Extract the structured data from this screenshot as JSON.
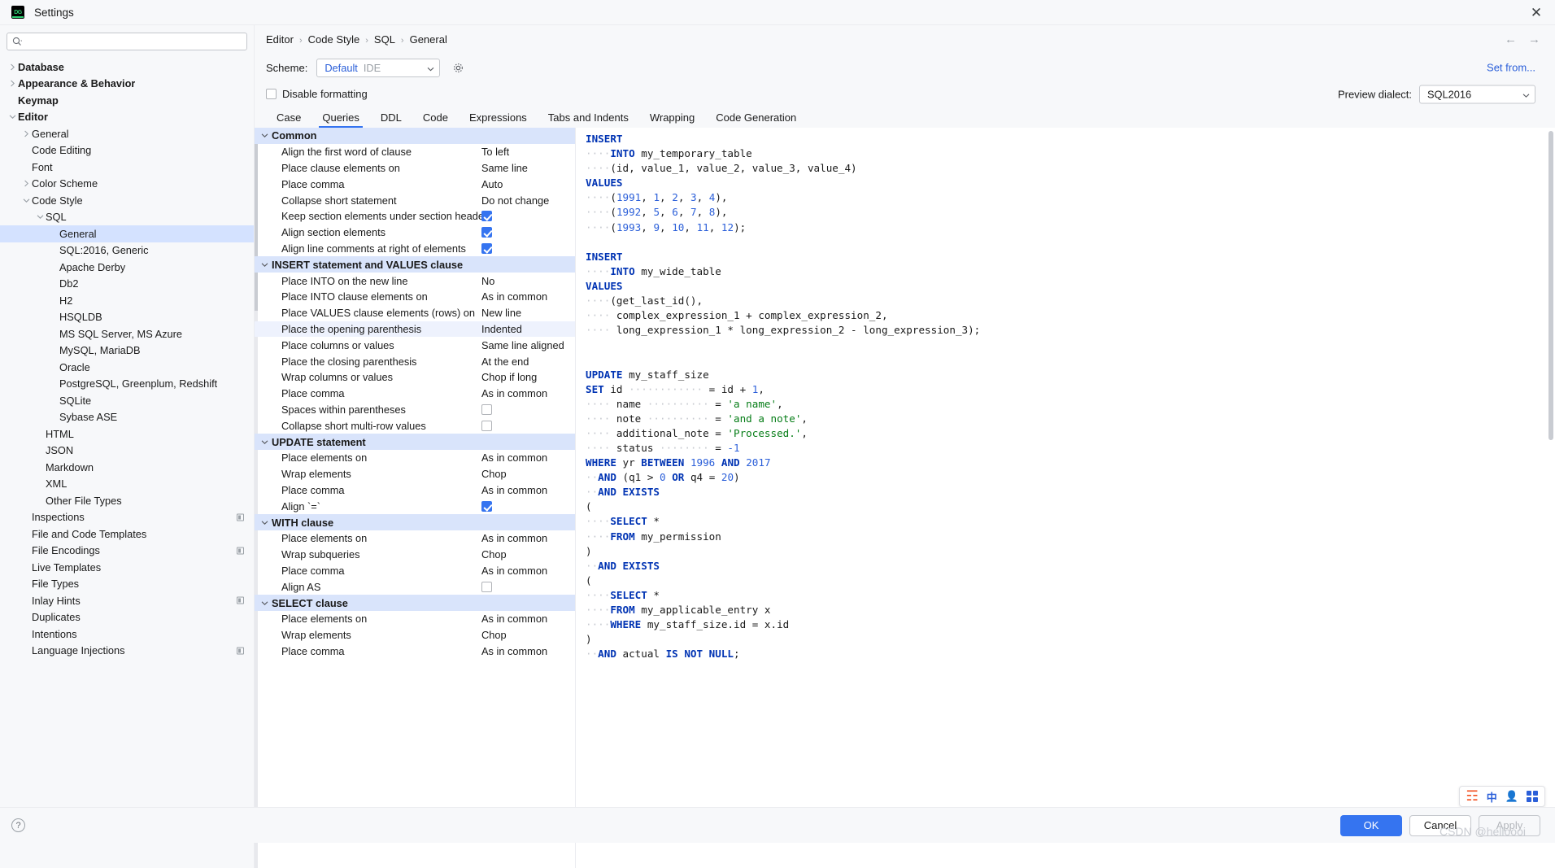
{
  "window": {
    "title": "Settings",
    "app_icon": "datagrip-icon",
    "close_icon": "close-icon"
  },
  "search": {
    "placeholder": "",
    "value": "",
    "icon": "search-icon"
  },
  "sidebar": {
    "items": [
      {
        "label": "Database",
        "depth": 0,
        "arrow": "right",
        "bold": true,
        "selected": false,
        "badge": false
      },
      {
        "label": "Appearance & Behavior",
        "depth": 0,
        "arrow": "right",
        "bold": true,
        "selected": false,
        "badge": false
      },
      {
        "label": "Keymap",
        "depth": 0,
        "arrow": "none",
        "bold": true,
        "selected": false,
        "badge": false
      },
      {
        "label": "Editor",
        "depth": 0,
        "arrow": "down",
        "bold": true,
        "selected": false,
        "badge": false
      },
      {
        "label": "General",
        "depth": 1,
        "arrow": "right",
        "bold": false,
        "selected": false,
        "badge": false
      },
      {
        "label": "Code Editing",
        "depth": 1,
        "arrow": "none",
        "bold": false,
        "selected": false,
        "badge": false
      },
      {
        "label": "Font",
        "depth": 1,
        "arrow": "none",
        "bold": false,
        "selected": false,
        "badge": false
      },
      {
        "label": "Color Scheme",
        "depth": 1,
        "arrow": "right",
        "bold": false,
        "selected": false,
        "badge": false
      },
      {
        "label": "Code Style",
        "depth": 1,
        "arrow": "down",
        "bold": false,
        "selected": false,
        "badge": false
      },
      {
        "label": "SQL",
        "depth": 2,
        "arrow": "down",
        "bold": false,
        "selected": false,
        "badge": false
      },
      {
        "label": "General",
        "depth": 3,
        "arrow": "none",
        "bold": false,
        "selected": true,
        "badge": false
      },
      {
        "label": "SQL:2016, Generic",
        "depth": 3,
        "arrow": "none",
        "bold": false,
        "selected": false,
        "badge": false
      },
      {
        "label": "Apache Derby",
        "depth": 3,
        "arrow": "none",
        "bold": false,
        "selected": false,
        "badge": false
      },
      {
        "label": "Db2",
        "depth": 3,
        "arrow": "none",
        "bold": false,
        "selected": false,
        "badge": false
      },
      {
        "label": "H2",
        "depth": 3,
        "arrow": "none",
        "bold": false,
        "selected": false,
        "badge": false
      },
      {
        "label": "HSQLDB",
        "depth": 3,
        "arrow": "none",
        "bold": false,
        "selected": false,
        "badge": false
      },
      {
        "label": "MS SQL Server, MS Azure",
        "depth": 3,
        "arrow": "none",
        "bold": false,
        "selected": false,
        "badge": false
      },
      {
        "label": "MySQL, MariaDB",
        "depth": 3,
        "arrow": "none",
        "bold": false,
        "selected": false,
        "badge": false
      },
      {
        "label": "Oracle",
        "depth": 3,
        "arrow": "none",
        "bold": false,
        "selected": false,
        "badge": false
      },
      {
        "label": "PostgreSQL, Greenplum, Redshift",
        "depth": 3,
        "arrow": "none",
        "bold": false,
        "selected": false,
        "badge": false
      },
      {
        "label": "SQLite",
        "depth": 3,
        "arrow": "none",
        "bold": false,
        "selected": false,
        "badge": false
      },
      {
        "label": "Sybase ASE",
        "depth": 3,
        "arrow": "none",
        "bold": false,
        "selected": false,
        "badge": false
      },
      {
        "label": "HTML",
        "depth": 2,
        "arrow": "none",
        "bold": false,
        "selected": false,
        "badge": false
      },
      {
        "label": "JSON",
        "depth": 2,
        "arrow": "none",
        "bold": false,
        "selected": false,
        "badge": false
      },
      {
        "label": "Markdown",
        "depth": 2,
        "arrow": "none",
        "bold": false,
        "selected": false,
        "badge": false
      },
      {
        "label": "XML",
        "depth": 2,
        "arrow": "none",
        "bold": false,
        "selected": false,
        "badge": false
      },
      {
        "label": "Other File Types",
        "depth": 2,
        "arrow": "none",
        "bold": false,
        "selected": false,
        "badge": false
      },
      {
        "label": "Inspections",
        "depth": 1,
        "arrow": "none",
        "bold": false,
        "selected": false,
        "badge": true
      },
      {
        "label": "File and Code Templates",
        "depth": 1,
        "arrow": "none",
        "bold": false,
        "selected": false,
        "badge": false
      },
      {
        "label": "File Encodings",
        "depth": 1,
        "arrow": "none",
        "bold": false,
        "selected": false,
        "badge": true
      },
      {
        "label": "Live Templates",
        "depth": 1,
        "arrow": "none",
        "bold": false,
        "selected": false,
        "badge": false
      },
      {
        "label": "File Types",
        "depth": 1,
        "arrow": "none",
        "bold": false,
        "selected": false,
        "badge": false
      },
      {
        "label": "Inlay Hints",
        "depth": 1,
        "arrow": "none",
        "bold": false,
        "selected": false,
        "badge": true
      },
      {
        "label": "Duplicates",
        "depth": 1,
        "arrow": "none",
        "bold": false,
        "selected": false,
        "badge": false
      },
      {
        "label": "Intentions",
        "depth": 1,
        "arrow": "none",
        "bold": false,
        "selected": false,
        "badge": false
      },
      {
        "label": "Language Injections",
        "depth": 1,
        "arrow": "none",
        "bold": false,
        "selected": false,
        "badge": true
      }
    ]
  },
  "breadcrumb": {
    "items": [
      "Editor",
      "Code Style",
      "SQL",
      "General"
    ],
    "separator": "›"
  },
  "nav": {
    "back_icon": "arrow-left-icon",
    "forward_icon": "arrow-right-icon"
  },
  "scheme": {
    "label": "Scheme:",
    "value": "Default",
    "suffix": "IDE",
    "gear_icon": "gear-icon",
    "chevron_icon": "chevron-down-icon"
  },
  "set_from": {
    "label": "Set from..."
  },
  "disable_formatting": {
    "label": "Disable formatting",
    "checked": false
  },
  "preview_dialect": {
    "label": "Preview dialect:",
    "value": "SQL2016",
    "chevron_icon": "chevron-down-icon"
  },
  "tabs": [
    {
      "label": "Case",
      "active": false
    },
    {
      "label": "Queries",
      "active": true
    },
    {
      "label": "DDL",
      "active": false
    },
    {
      "label": "Code",
      "active": false
    },
    {
      "label": "Expressions",
      "active": false
    },
    {
      "label": "Tabs and Indents",
      "active": false
    },
    {
      "label": "Wrapping",
      "active": false
    },
    {
      "label": "Code Generation",
      "active": false
    }
  ],
  "options": [
    {
      "type": "group",
      "name": "Common",
      "value": "",
      "highlight": false
    },
    {
      "type": "item",
      "name": "Align the first word of clause",
      "value": "To left",
      "kind": "text"
    },
    {
      "type": "item",
      "name": "Place clause elements on",
      "value": "Same line",
      "kind": "text"
    },
    {
      "type": "item",
      "name": "Place comma",
      "value": "Auto",
      "kind": "text"
    },
    {
      "type": "item",
      "name": "Collapse short statement",
      "value": "Do not change",
      "kind": "text"
    },
    {
      "type": "item",
      "name": "Keep section elements under section header",
      "value": "",
      "kind": "checkbox",
      "checked": true
    },
    {
      "type": "item",
      "name": "Align section elements",
      "value": "",
      "kind": "checkbox",
      "checked": true
    },
    {
      "type": "item",
      "name": "Align line comments at right of elements",
      "value": "",
      "kind": "checkbox",
      "checked": true
    },
    {
      "type": "group",
      "name": "INSERT statement and VALUES clause",
      "value": ""
    },
    {
      "type": "item",
      "name": "Place INTO on the new line",
      "value": "No",
      "kind": "text"
    },
    {
      "type": "item",
      "name": "Place INTO clause elements on",
      "value": "As in common",
      "kind": "text"
    },
    {
      "type": "item",
      "name": "Place VALUES clause elements (rows) on",
      "value": "New line",
      "kind": "text"
    },
    {
      "type": "item",
      "name": "Place the opening parenthesis",
      "value": "Indented",
      "kind": "text",
      "highlight": true
    },
    {
      "type": "item",
      "name": "Place columns or values",
      "value": "Same line aligned",
      "kind": "text"
    },
    {
      "type": "item",
      "name": "Place the closing parenthesis",
      "value": "At the end",
      "kind": "text"
    },
    {
      "type": "item",
      "name": "Wrap columns or values",
      "value": "Chop if long",
      "kind": "text"
    },
    {
      "type": "item",
      "name": "Place comma",
      "value": "As in common",
      "kind": "text"
    },
    {
      "type": "item",
      "name": "Spaces within parentheses",
      "value": "",
      "kind": "checkbox",
      "checked": false
    },
    {
      "type": "item",
      "name": "Collapse short multi-row values",
      "value": "",
      "kind": "checkbox",
      "checked": false
    },
    {
      "type": "group",
      "name": "UPDATE statement",
      "value": ""
    },
    {
      "type": "item",
      "name": "Place elements on",
      "value": "As in common",
      "kind": "text"
    },
    {
      "type": "item",
      "name": "Wrap elements",
      "value": "Chop",
      "kind": "text"
    },
    {
      "type": "item",
      "name": "Place comma",
      "value": "As in common",
      "kind": "text"
    },
    {
      "type": "item",
      "name": "Align `=`",
      "value": "",
      "kind": "checkbox",
      "checked": true
    },
    {
      "type": "group",
      "name": "WITH clause",
      "value": ""
    },
    {
      "type": "item",
      "name": "Place elements on",
      "value": "As in common",
      "kind": "text"
    },
    {
      "type": "item",
      "name": "Wrap subqueries",
      "value": "Chop",
      "kind": "text"
    },
    {
      "type": "item",
      "name": "Place comma",
      "value": "As in common",
      "kind": "text"
    },
    {
      "type": "item",
      "name": "Align AS",
      "value": "",
      "kind": "checkbox",
      "checked": false
    },
    {
      "type": "group",
      "name": "SELECT clause",
      "value": ""
    },
    {
      "type": "item",
      "name": "Place elements on",
      "value": "As in common",
      "kind": "text"
    },
    {
      "type": "item",
      "name": "Wrap elements",
      "value": "Chop",
      "kind": "text"
    },
    {
      "type": "item",
      "name": "Place comma",
      "value": "As in common",
      "kind": "text"
    }
  ],
  "preview_code": [
    [
      [
        "kw",
        "INSERT"
      ]
    ],
    [
      [
        "dot",
        "····"
      ],
      [
        "kw",
        "INTO"
      ],
      [
        "id",
        " my_temporary_table"
      ]
    ],
    [
      [
        "dot",
        "····"
      ],
      [
        "id",
        "(id, value_1, value_2, value_3, value_4)"
      ]
    ],
    [
      [
        "kw",
        "VALUES"
      ]
    ],
    [
      [
        "dot",
        "····"
      ],
      [
        "id",
        "("
      ],
      [
        "num",
        "1991"
      ],
      [
        "id",
        ", "
      ],
      [
        "num",
        "1"
      ],
      [
        "id",
        ", "
      ],
      [
        "num",
        "2"
      ],
      [
        "id",
        ", "
      ],
      [
        "num",
        "3"
      ],
      [
        "id",
        ", "
      ],
      [
        "num",
        "4"
      ],
      [
        "id",
        "),"
      ]
    ],
    [
      [
        "dot",
        "····"
      ],
      [
        "id",
        "("
      ],
      [
        "num",
        "1992"
      ],
      [
        "id",
        ", "
      ],
      [
        "num",
        "5"
      ],
      [
        "id",
        ", "
      ],
      [
        "num",
        "6"
      ],
      [
        "id",
        ", "
      ],
      [
        "num",
        "7"
      ],
      [
        "id",
        ", "
      ],
      [
        "num",
        "8"
      ],
      [
        "id",
        "),"
      ]
    ],
    [
      [
        "dot",
        "····"
      ],
      [
        "id",
        "("
      ],
      [
        "num",
        "1993"
      ],
      [
        "id",
        ", "
      ],
      [
        "num",
        "9"
      ],
      [
        "id",
        ", "
      ],
      [
        "num",
        "10"
      ],
      [
        "id",
        ", "
      ],
      [
        "num",
        "11"
      ],
      [
        "id",
        ", "
      ],
      [
        "num",
        "12"
      ],
      [
        "id",
        ");"
      ]
    ],
    [
      [
        "id",
        ""
      ]
    ],
    [
      [
        "kw",
        "INSERT"
      ]
    ],
    [
      [
        "dot",
        "····"
      ],
      [
        "kw",
        "INTO"
      ],
      [
        "id",
        " my_wide_table"
      ]
    ],
    [
      [
        "kw",
        "VALUES"
      ]
    ],
    [
      [
        "dot",
        "····"
      ],
      [
        "id",
        "(get_last_id(),"
      ]
    ],
    [
      [
        "dot",
        "····"
      ],
      [
        "id",
        " complex_expression_1 + complex_expression_2,"
      ]
    ],
    [
      [
        "dot",
        "····"
      ],
      [
        "id",
        " long_expression_1 * long_expression_2 - long_expression_3);"
      ]
    ],
    [
      [
        "id",
        ""
      ]
    ],
    [
      [
        "id",
        ""
      ]
    ],
    [
      [
        "kw",
        "UPDATE"
      ],
      [
        "id",
        " my_staff_size"
      ]
    ],
    [
      [
        "kw",
        "SET"
      ],
      [
        "id",
        " id"
      ],
      [
        "dot",
        " ············"
      ],
      [
        "id",
        " = id + "
      ],
      [
        "num",
        "1"
      ],
      [
        "id",
        ","
      ]
    ],
    [
      [
        "dot",
        "····"
      ],
      [
        "id",
        " name"
      ],
      [
        "dot",
        " ··········"
      ],
      [
        "id",
        " = "
      ],
      [
        "str",
        "'a name'"
      ],
      [
        "id",
        ","
      ]
    ],
    [
      [
        "dot",
        "····"
      ],
      [
        "id",
        " note"
      ],
      [
        "dot",
        " ··········"
      ],
      [
        "id",
        " = "
      ],
      [
        "str",
        "'and a note'"
      ],
      [
        "id",
        ","
      ]
    ],
    [
      [
        "dot",
        "····"
      ],
      [
        "id",
        " additional_note = "
      ],
      [
        "str",
        "'Processed.'"
      ],
      [
        "id",
        ","
      ]
    ],
    [
      [
        "dot",
        "····"
      ],
      [
        "id",
        " status"
      ],
      [
        "dot",
        " ········"
      ],
      [
        "id",
        " = "
      ],
      [
        "num",
        "-1"
      ]
    ],
    [
      [
        "kw",
        "WHERE"
      ],
      [
        "id",
        " yr "
      ],
      [
        "kw",
        "BETWEEN"
      ],
      [
        "id",
        " "
      ],
      [
        "num",
        "1996"
      ],
      [
        "id",
        " "
      ],
      [
        "kw",
        "AND"
      ],
      [
        "id",
        " "
      ],
      [
        "num",
        "2017"
      ]
    ],
    [
      [
        "dot",
        "··"
      ],
      [
        "kw",
        "AND"
      ],
      [
        "id",
        " (q1 > "
      ],
      [
        "num",
        "0"
      ],
      [
        "id",
        " "
      ],
      [
        "kw",
        "OR"
      ],
      [
        "id",
        " q4 = "
      ],
      [
        "num",
        "20"
      ],
      [
        "id",
        ")"
      ]
    ],
    [
      [
        "dot",
        "··"
      ],
      [
        "kw",
        "AND EXISTS"
      ]
    ],
    [
      [
        "id",
        "("
      ]
    ],
    [
      [
        "dot",
        "····"
      ],
      [
        "kw",
        "SELECT"
      ],
      [
        "id",
        " *"
      ]
    ],
    [
      [
        "dot",
        "····"
      ],
      [
        "kw",
        "FROM"
      ],
      [
        "id",
        " my_permission"
      ]
    ],
    [
      [
        "id",
        ")"
      ]
    ],
    [
      [
        "dot",
        "··"
      ],
      [
        "kw",
        "AND EXISTS"
      ]
    ],
    [
      [
        "id",
        "("
      ]
    ],
    [
      [
        "dot",
        "····"
      ],
      [
        "kw",
        "SELECT"
      ],
      [
        "id",
        " *"
      ]
    ],
    [
      [
        "dot",
        "····"
      ],
      [
        "kw",
        "FROM"
      ],
      [
        "id",
        " my_applicable_entry x"
      ]
    ],
    [
      [
        "dot",
        "····"
      ],
      [
        "kw",
        "WHERE"
      ],
      [
        "id",
        " my_staff_size.id = x.id"
      ]
    ],
    [
      [
        "id",
        ")"
      ]
    ],
    [
      [
        "dot",
        "··"
      ],
      [
        "kw",
        "AND"
      ],
      [
        "id",
        " actual "
      ],
      [
        "kw",
        "IS NOT NULL"
      ],
      [
        "id",
        ";"
      ]
    ]
  ],
  "footer": {
    "help_icon": "help-icon",
    "ok_label": "OK",
    "cancel_label": "Cancel",
    "apply_label": "Apply"
  },
  "tray": {
    "sogou_icon": "sogou-icon",
    "chinese_mode": "中",
    "user_icon": "user-31-icon",
    "grid_icon": "grid-icon"
  },
  "watermark": {
    "text": "CSDN @helloooi"
  }
}
